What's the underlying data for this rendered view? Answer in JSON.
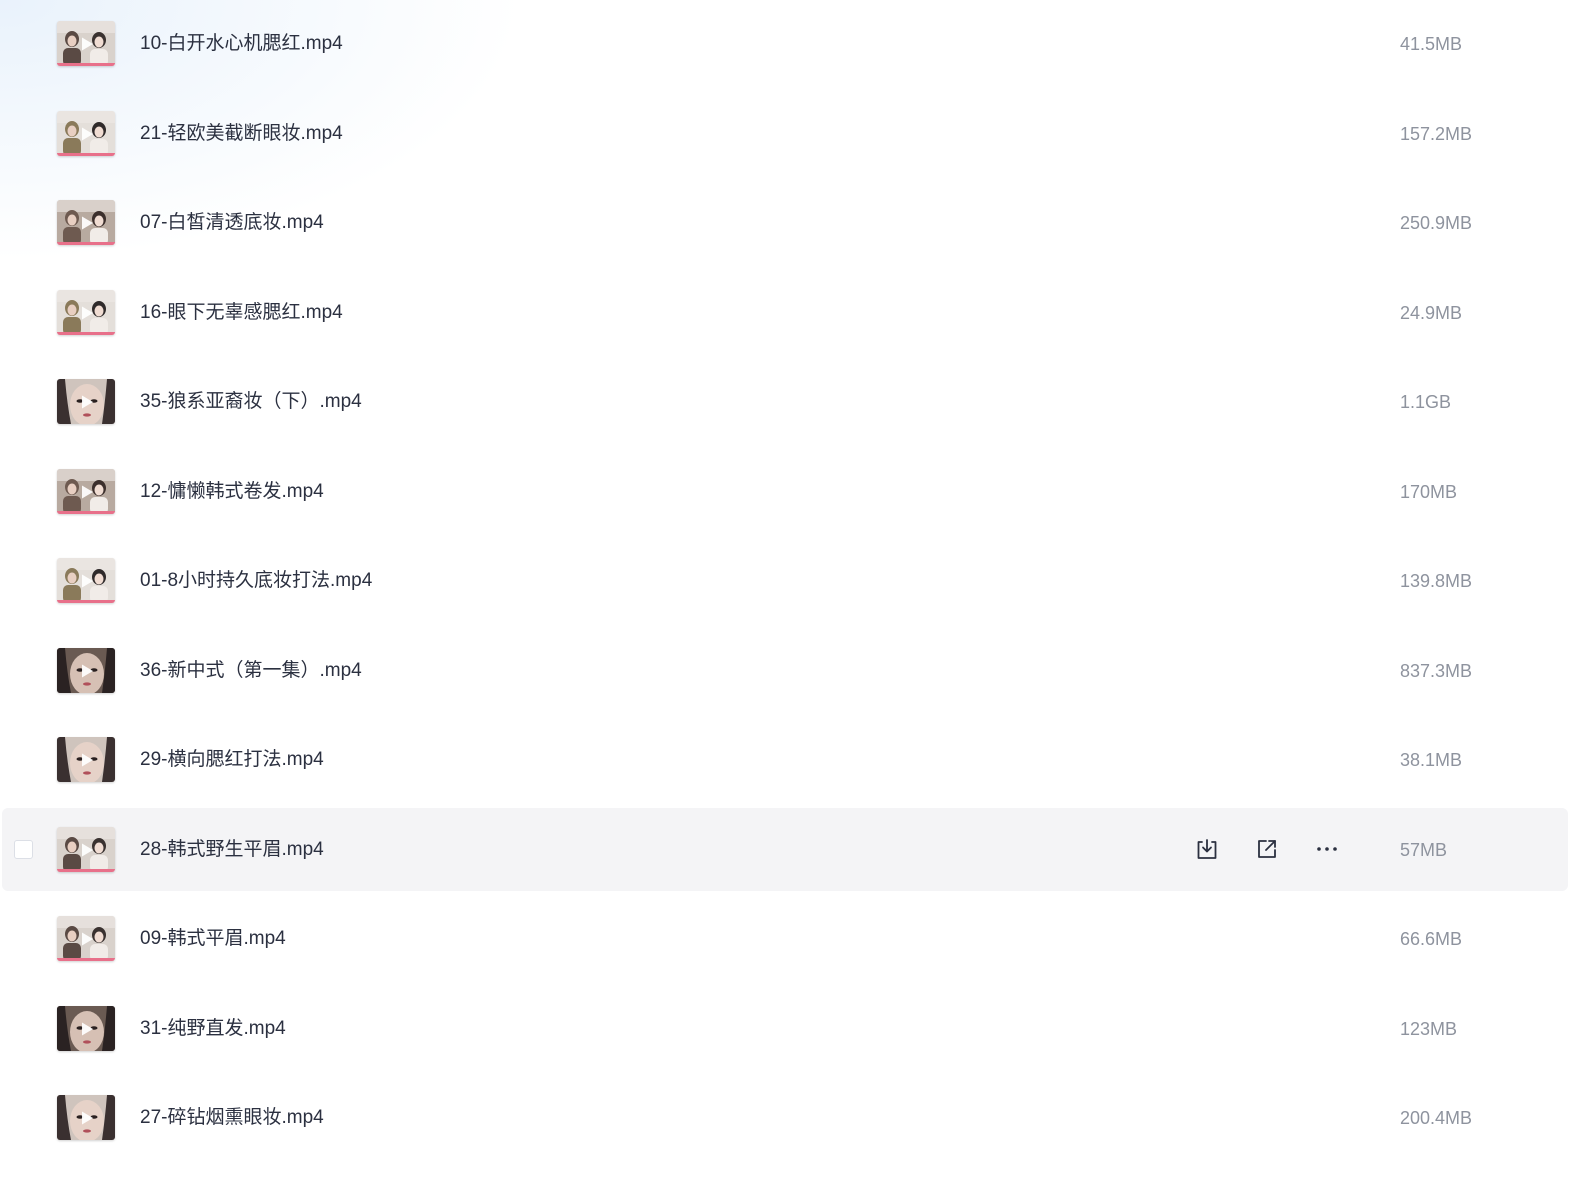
{
  "files": [
    {
      "name": "10-白开水心机腮红.mp4",
      "size": "41.5MB",
      "thumb": "scene-a",
      "selected": false
    },
    {
      "name": "21-轻欧美截断眼妆.mp4",
      "size": "157.2MB",
      "thumb": "scene-b",
      "selected": false
    },
    {
      "name": "07-白皙清透底妆.mp4",
      "size": "250.9MB",
      "thumb": "scene-c",
      "selected": false
    },
    {
      "name": "16-眼下无辜感腮红.mp4",
      "size": "24.9MB",
      "thumb": "scene-b",
      "selected": false
    },
    {
      "name": "35-狼系亚裔妆（下）.mp4",
      "size": "1.1GB",
      "thumb": "closeup",
      "selected": false
    },
    {
      "name": "12-慵懒韩式卷发.mp4",
      "size": "170MB",
      "thumb": "scene-c",
      "selected": false
    },
    {
      "name": "01-8小时持久底妆打法.mp4",
      "size": "139.8MB",
      "thumb": "scene-b",
      "selected": false
    },
    {
      "name": "36-新中式（第一集）.mp4",
      "size": "837.3MB",
      "thumb": "closeup-dark",
      "selected": false
    },
    {
      "name": "29-横向腮红打法.mp4",
      "size": "38.1MB",
      "thumb": "closeup",
      "selected": false
    },
    {
      "name": "28-韩式野生平眉.mp4",
      "size": "57MB",
      "thumb": "scene-a",
      "selected": true
    },
    {
      "name": "09-韩式平眉.mp4",
      "size": "66.6MB",
      "thumb": "scene-a",
      "selected": false
    },
    {
      "name": "31-纯野直发.mp4",
      "size": "123MB",
      "thumb": "closeup-dark",
      "selected": false
    },
    {
      "name": "27-碎钻烟熏眼妆.mp4",
      "size": "200.4MB",
      "thumb": "closeup",
      "selected": false
    }
  ],
  "icons": {
    "play": "play-icon",
    "download": "download-icon",
    "share": "share-icon",
    "more": "more-icon"
  },
  "colors": {
    "text": "#2b3040",
    "size_text": "#8e939e",
    "selected_row": "#f4f4f6",
    "thumb_accent": "#e8708a"
  }
}
